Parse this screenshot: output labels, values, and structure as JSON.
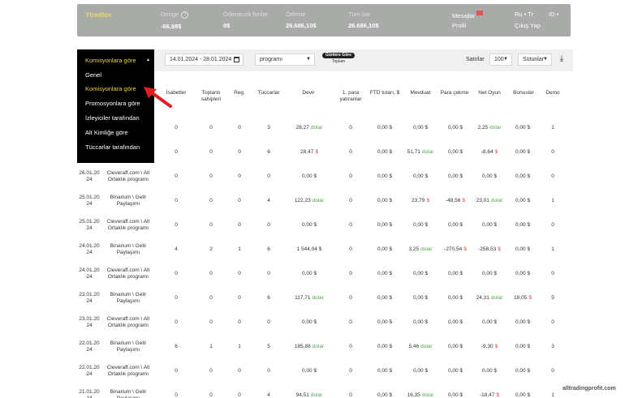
{
  "topbar": {
    "brand": "Ytredfox",
    "stats": [
      {
        "label": "Denge",
        "value": "-66,98$"
      },
      {
        "label": "Ödenecek fonlar",
        "value": "0$"
      },
      {
        "label": "Ödeme",
        "value": "26.686,10$"
      },
      {
        "label": "Tüm kar",
        "value": "26.686,10$"
      }
    ],
    "messages": "Mesajlar",
    "profile": "Profil",
    "lang": "Ru • Tr",
    "logout": "Çıkış Yap",
    "id_label": "ID •"
  },
  "dropdown": {
    "selected": "Komisyonlara göre",
    "items": [
      "Genel",
      "Komisyonlara göre",
      "Promosyonlara göre",
      "İzleyiciler tarafından",
      "Alt Kimliğe göre",
      "Tüccarlar tarafından"
    ]
  },
  "filters": {
    "date_range": "14.01.2024 - 28.01.2024",
    "program": "programı",
    "group_by": "Günlere Göre",
    "total": "Toplam",
    "rows_label": "Satırlar",
    "rows_value": "100",
    "columns": "Sütunlar"
  },
  "table": {
    "headers": [
      "İsabetler",
      "Toplantı sahipleri",
      "Reg.",
      "Tüccarlar",
      "Devir",
      "1. para yatıranlar",
      "FTD tutarı, $",
      "Mevduat",
      "Para çekme",
      "Net Oyun",
      "Bonuslar",
      "Demo"
    ],
    "rows": [
      {
        "date": "",
        "program": "",
        "hits": "0",
        "hosts": "0",
        "reg": "0",
        "traders": "3",
        "devir": "28,27",
        "devir_cur": "dolar",
        "ftd": "0",
        "ftd_amt": "0,00 $",
        "deposit": "0,00 $",
        "deposit_cur": "",
        "withdraw": "0,00 $",
        "withdraw_cur": "",
        "net": "2,25",
        "net_cur": "dolar",
        "bonus": "0,00 $",
        "demo": "1"
      },
      {
        "date": "",
        "program": "",
        "hits": "0",
        "hosts": "0",
        "reg": "0",
        "traders": "6",
        "devir": "28,47",
        "devir_cur": "$",
        "ftd": "0",
        "ftd_amt": "0,00 $",
        "deposit": "51,71",
        "deposit_cur": "dolar",
        "withdraw": "0,00 $",
        "withdraw_cur": "",
        "net": "-8,64",
        "net_cur": "$",
        "bonus": "0,00 $",
        "demo": "0"
      },
      {
        "date": "26.01.20 24",
        "program": "Cleveraff.com \\ Alt Ortaklık programı",
        "hits": "0",
        "hosts": "0",
        "reg": "0",
        "traders": "0",
        "devir": "0,00 $",
        "devir_cur": "",
        "ftd": "0",
        "ftd_amt": "0,00 $",
        "deposit": "0,00 $",
        "deposit_cur": "",
        "withdraw": "0,00 $",
        "withdraw_cur": "",
        "net": "0,00 $",
        "net_cur": "",
        "bonus": "0,00 $",
        "demo": "0"
      },
      {
        "date": "25.01.20 24",
        "program": "Binarium \\ Gelir Paylaşımı",
        "hits": "0",
        "hosts": "0",
        "reg": "0",
        "traders": "4",
        "devir": "122,23",
        "devir_cur": "dolar",
        "ftd": "0",
        "ftd_amt": "0,00 $",
        "deposit": "23,79",
        "deposit_cur": "$",
        "withdraw": "-48,56",
        "withdraw_cur": "$",
        "net": "23,01",
        "net_cur": "dolar",
        "bonus": "0,00 $",
        "demo": "1"
      },
      {
        "date": "25.01.20 24",
        "program": "Cleveraff.com \\ Alt Ortaklık programı",
        "hits": "0",
        "hosts": "0",
        "reg": "0",
        "traders": "0",
        "devir": "0,00 $",
        "devir_cur": "",
        "ftd": "0",
        "ftd_amt": "0,00 $",
        "deposit": "0,00 $",
        "deposit_cur": "",
        "withdraw": "0,00 $",
        "withdraw_cur": "",
        "net": "0,00 $",
        "net_cur": "",
        "bonus": "0,00 $",
        "demo": "0"
      },
      {
        "date": "24.01.20 24",
        "program": "Binarium \\ Gelir Paylaşımı",
        "hits": "4",
        "hosts": "2",
        "reg": "1",
        "traders": "6",
        "devir": "1 544,04 $",
        "devir_cur": "",
        "ftd": "0",
        "ftd_amt": "0,00 $",
        "deposit": "3,25",
        "deposit_cur": "dolar",
        "withdraw": "-270,54",
        "withdraw_cur": "$",
        "net": "-258,53",
        "net_cur": "$",
        "bonus": "0,00 $",
        "demo": "1"
      },
      {
        "date": "24.01.20 24",
        "program": "Cleveraff.com \\ Alt Ortaklık programı",
        "hits": "0",
        "hosts": "0",
        "reg": "0",
        "traders": "0",
        "devir": "0,00 $",
        "devir_cur": "",
        "ftd": "0",
        "ftd_amt": "0,00 $",
        "deposit": "0,00 $",
        "deposit_cur": "",
        "withdraw": "0,00 $",
        "withdraw_cur": "",
        "net": "0,00 $",
        "net_cur": "",
        "bonus": "0,00 $",
        "demo": "0"
      },
      {
        "date": "23.01.20 24",
        "program": "Binarium \\ Gelir Paylaşımı",
        "hits": "0",
        "hosts": "0",
        "reg": "0",
        "traders": "6",
        "devir": "117,71",
        "devir_cur": "dolar",
        "ftd": "0",
        "ftd_amt": "0,00 $",
        "deposit": "0,00 $",
        "deposit_cur": "",
        "withdraw": "0,00 $",
        "withdraw_cur": "",
        "net": "24,31",
        "net_cur": "dolar",
        "bonus": "18,05",
        "bonus_cur": "$",
        "demo": "5"
      },
      {
        "date": "23.01.20 24",
        "program": "Cleveraff.com \\ Alt Ortaklık programı",
        "hits": "0",
        "hosts": "0",
        "reg": "0",
        "traders": "0",
        "devir": "0,00 $",
        "devir_cur": "",
        "ftd": "0",
        "ftd_amt": "0,00 $",
        "deposit": "0,00 $",
        "deposit_cur": "",
        "withdraw": "0,00 $",
        "withdraw_cur": "",
        "net": "0,00 $",
        "net_cur": "",
        "bonus": "0,00 $",
        "demo": "0"
      },
      {
        "date": "22.01.20 24",
        "program": "Binarium \\ Gelir Paylaşımı",
        "hits": "6",
        "hosts": "1",
        "reg": "1",
        "traders": "5",
        "devir": "185,88",
        "devir_cur": "dolar",
        "ftd": "0",
        "ftd_amt": "0,00 $",
        "deposit": "5,46",
        "deposit_cur": "dolar",
        "withdraw": "0,00 $",
        "withdraw_cur": "",
        "net": "-9,30",
        "net_cur": "$",
        "bonus": "0,00 $",
        "demo": "3"
      },
      {
        "date": "22.01.20 24",
        "program": "Cleveraff.com \\ Alt Ortaklık programı",
        "hits": "0",
        "hosts": "0",
        "reg": "0",
        "traders": "0",
        "devir": "0,00 $",
        "devir_cur": "",
        "ftd": "0",
        "ftd_amt": "0,00 $",
        "deposit": "0,00 $",
        "deposit_cur": "",
        "withdraw": "0,00 $",
        "withdraw_cur": "",
        "net": "0,00 $",
        "net_cur": "",
        "bonus": "0,00 $",
        "demo": "0"
      },
      {
        "date": "21.01.20 24",
        "program": "Binarium \\ Gelir Paylaşımı",
        "hits": "0",
        "hosts": "0",
        "reg": "0",
        "traders": "4",
        "devir": "94,51",
        "devir_cur": "dolar",
        "ftd": "0",
        "ftd_amt": "0,00 $",
        "deposit": "16,35",
        "deposit_cur": "dolar",
        "withdraw": "0,00 $",
        "withdraw_cur": "",
        "net": "-18,47",
        "net_cur": "$",
        "bonus": "0,00 $",
        "demo": "1"
      }
    ]
  },
  "watermark": "alltradingprofit.com"
}
